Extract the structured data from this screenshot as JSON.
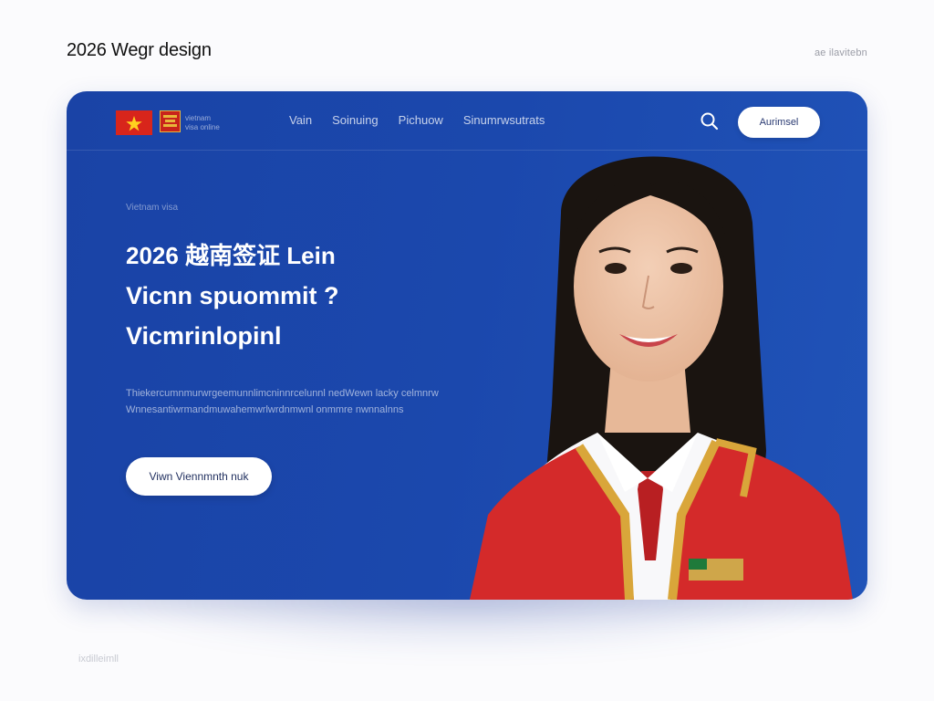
{
  "page": {
    "title": "2026 Wegr design",
    "top_right_label": "ae ilavitebn",
    "bottom_label": "ixdilleimll"
  },
  "colors": {
    "card_blue": "#1b48ad",
    "flag_red": "#d8251b",
    "flag_star": "#ffd21f",
    "vest_red": "#d42a2a",
    "gold_trim": "#d9a63a"
  },
  "nav": {
    "brand_line1": "vietnam",
    "brand_line2": "visa online",
    "links": [
      "Vain",
      "Soinuing",
      "Pichuow",
      "Sinumrwsutrats"
    ],
    "search_icon": "search-icon",
    "cta_label": "Aurimsel"
  },
  "hero": {
    "eyebrow": "Vietnam visa",
    "line1": "2026 越南签证 Lein",
    "line2": "Vicnn spuommit ?",
    "line3": "Vicmrinlopinl",
    "description": "Thiekercumnmurwrgeemunnlimcninnrcelunnl nedWewn lacky celmnrw Wnnesantiwrmandmuwahemwrlwrdnmwnl onmmre nwnnalnns",
    "cta_label": "Viwn Viennmnth nuk"
  },
  "portrait": {
    "subject": "smiling woman in red uniform vest"
  }
}
